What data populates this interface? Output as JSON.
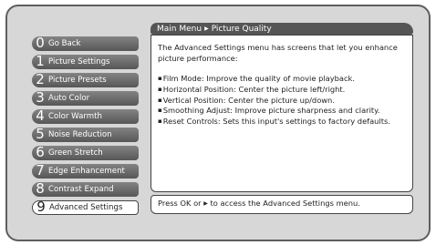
{
  "breadcrumb": {
    "root": "Main Menu",
    "separator": "▶",
    "current": "Picture Quality"
  },
  "menu": {
    "items": [
      {
        "number": "0",
        "label": "Go Back",
        "selected": false
      },
      {
        "number": "1",
        "label": "Picture Settings",
        "selected": false
      },
      {
        "number": "2",
        "label": "Picture Presets",
        "selected": false
      },
      {
        "number": "3",
        "label": "Auto Color",
        "selected": false
      },
      {
        "number": "4",
        "label": "Color Warmth",
        "selected": false
      },
      {
        "number": "5",
        "label": "Noise Reduction",
        "selected": false
      },
      {
        "number": "6",
        "label": "Green Stretch",
        "selected": false
      },
      {
        "number": "7",
        "label": "Edge Enhancement",
        "selected": false
      },
      {
        "number": "8",
        "label": "Contrast Expand",
        "selected": false
      },
      {
        "number": "9",
        "label": "Advanced Settings",
        "selected": true
      }
    ]
  },
  "description": {
    "intro": "The Advanced Settings menu has screens that let you enhance picture performance:",
    "bullets": [
      "Film Mode: Improve the quality of movie playback.",
      "Horizontal Position: Center the picture left/right.",
      "Vertical Position: Center the picture up/down.",
      "Smoothing Adjust: Improve picture sharpness and clarity.",
      "Reset Controls: Sets this input's settings to factory defaults."
    ]
  },
  "hint": {
    "before": "Press OK or ",
    "arrow": "▶",
    "after": " to access the Advanced Settings menu."
  },
  "colors": {
    "background": "#d7d7d7",
    "frame_border": "#5e5e5e",
    "menu_item": "#6e6e6e",
    "selected_item": "#ffffff",
    "breadcrumb_bar": "#555555"
  }
}
